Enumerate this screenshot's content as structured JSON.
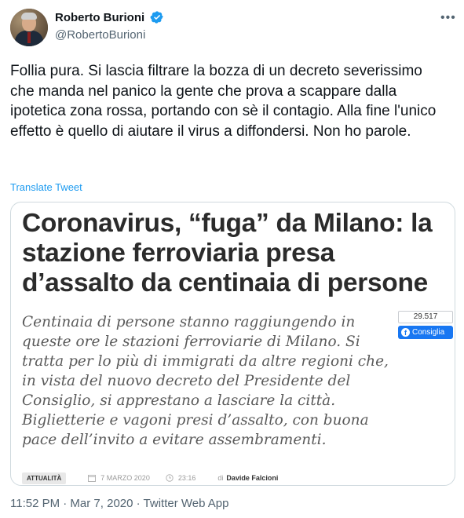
{
  "user": {
    "name": "Roberto Burioni",
    "handle": "@RobertoBurioni"
  },
  "tweet": {
    "text": "Follia pura. Si lascia filtrare la bozza di un decreto severissimo che manda nel panico la gente che prova a scappare dalla ipotetica zona rossa, portando con sè il contagio. Alla fine l'unico effetto è quello di aiutare il virus a diffondersi. Non ho parole.",
    "translate_label": "Translate Tweet",
    "footer": "11:52 PM · Mar 7, 2020 · Twitter Web App"
  },
  "article": {
    "headline": "Coronavirus, “fuga” da Milano: la stazione ferroviaria presa d’assalto da centinaia di persone",
    "subheadline": "Centinaia di persone stanno raggiungendo in queste ore le stazioni ferroviarie di Milano. Si tratta per lo più di immigrati da altre regioni che, in vista del nuovo decreto del Presidente del Consiglio, si apprestano a lasciare la città. Biglietterie e vagoni presi d’assalto, con buona pace dell’invito a evitare assembramenti.",
    "fb_count": "29.517",
    "fb_label": "Consiglia",
    "category": "ATTUALITÀ",
    "date": "7 MARZO 2020",
    "time": "23:16",
    "by_label": "di",
    "author": "Davide Falcioni"
  },
  "icons": {
    "verified": "verified-badge-icon",
    "more": "more-options-icon",
    "facebook": "facebook-icon",
    "calendar": "calendar-icon",
    "clock": "clock-icon"
  },
  "colors": {
    "accent": "#1d9bf0",
    "facebook": "#1877f2",
    "text": "#0f1419",
    "secondary": "#536471"
  }
}
